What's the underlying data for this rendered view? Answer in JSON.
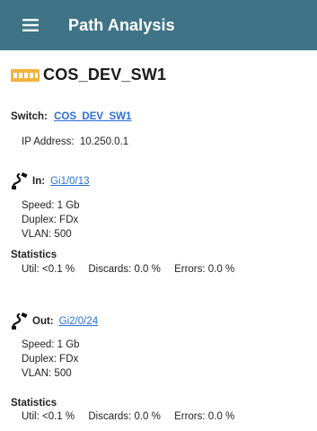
{
  "appbar": {
    "title": "Path Analysis",
    "menu_icon": "hamburger-menu-icon"
  },
  "device": {
    "name": "COS_DEV_SW1",
    "icon": "network-switch-icon"
  },
  "switch": {
    "label": "Switch:",
    "value": "COS_DEV_SW1",
    "ip_label": "IP Address:",
    "ip_value": "10.250.0.1"
  },
  "in_port": {
    "label": "In:",
    "port": "Gi1/0/13",
    "speed": "Speed: 1 Gb",
    "duplex": "Duplex: FDx",
    "vlan": "VLAN: 500",
    "stats_title": "Statistics",
    "util": "Util: <0.1 %",
    "discards": "Discards: 0.0 %",
    "errors": "Errors: 0.0 %"
  },
  "out_port": {
    "label": "Out:",
    "port": "Gi2/0/24",
    "speed": "Speed: 1 Gb",
    "duplex": "Duplex: FDx",
    "vlan": "VLAN: 500",
    "stats_title": "Statistics",
    "util": "Util: <0.1 %",
    "discards": "Discards: 0.0 %",
    "errors": "Errors: 0.0 %"
  },
  "colors": {
    "appbar": "#3f7487",
    "link": "#2a6fd6",
    "switch_icon": "#f2b33d"
  }
}
